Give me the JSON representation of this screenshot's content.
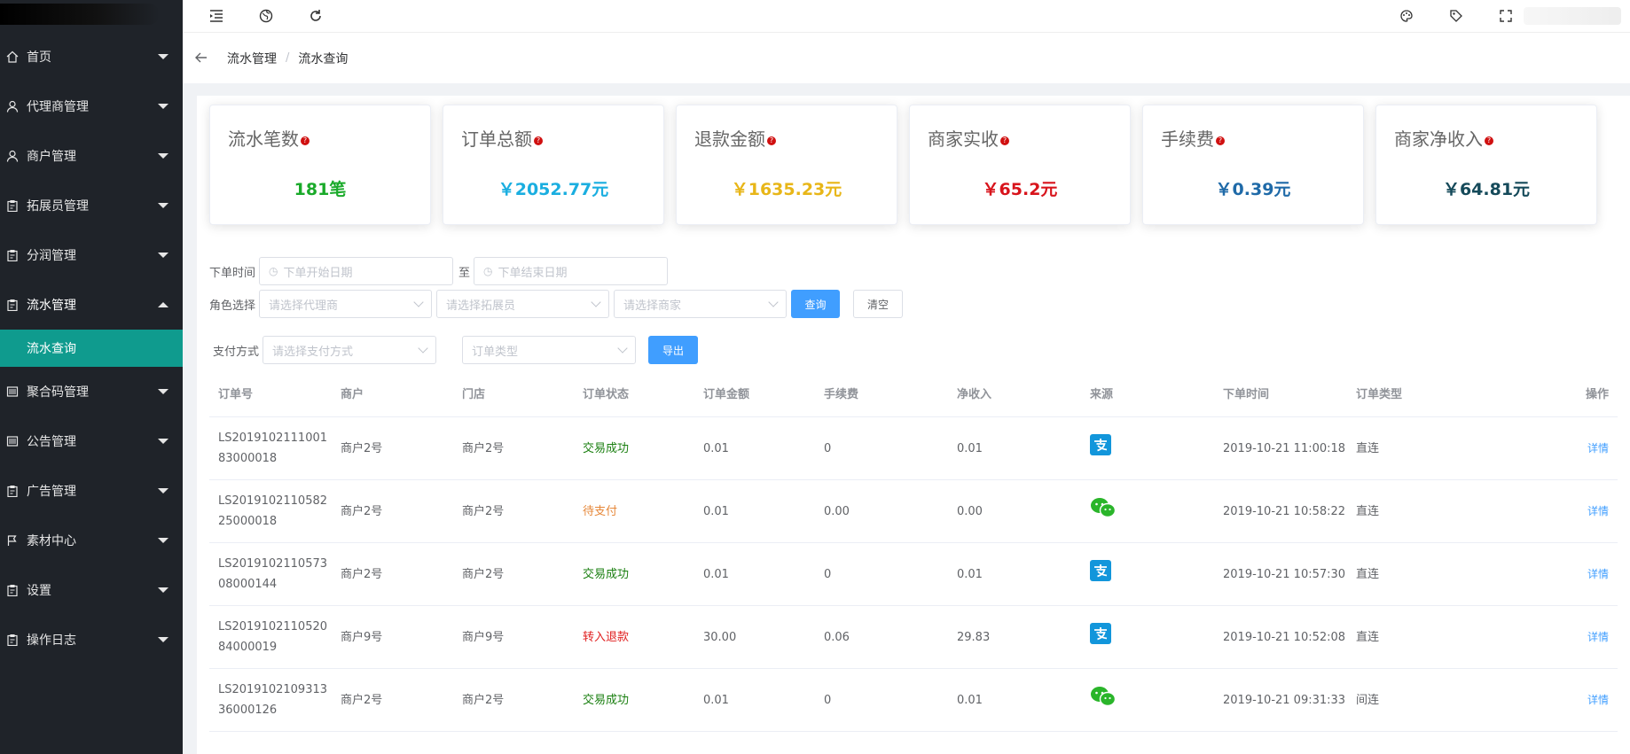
{
  "sidebar": {
    "items": [
      {
        "label": "首页",
        "icon": "home-icon"
      },
      {
        "label": "代理商管理",
        "icon": "user-icon"
      },
      {
        "label": "商户管理",
        "icon": "user-icon"
      },
      {
        "label": "拓展员管理",
        "icon": "clipboard-icon"
      },
      {
        "label": "分润管理",
        "icon": "clipboard-icon"
      },
      {
        "label": "流水管理",
        "icon": "clipboard-icon",
        "open": true
      },
      {
        "label": "聚合码管理",
        "icon": "barcode-icon"
      },
      {
        "label": "公告管理",
        "icon": "barcode-icon"
      },
      {
        "label": "广告管理",
        "icon": "clipboard-icon"
      },
      {
        "label": "素材中心",
        "icon": "flag-icon"
      },
      {
        "label": "设置",
        "icon": "clipboard-icon"
      },
      {
        "label": "操作日志",
        "icon": "clipboard-icon"
      }
    ],
    "submenu_active": "流水查询"
  },
  "header": {
    "left_icons": [
      "menu-fold-icon",
      "globe-icon",
      "refresh-icon"
    ],
    "right_icons": [
      "palette-icon",
      "tag-icon",
      "fullscreen-icon"
    ]
  },
  "breadcrumb": {
    "items": [
      "流水管理",
      "流水查询"
    ],
    "separator": "/"
  },
  "stats": [
    {
      "title": "流水笔数",
      "value": "181笔",
      "color": "#1aaa2a"
    },
    {
      "title": "订单总额",
      "value": "￥2052.77元",
      "color": "#1aaee0"
    },
    {
      "title": "退款金额",
      "value": "￥1635.23元",
      "color": "#e8b618"
    },
    {
      "title": "商家实收",
      "value": "￥65.2元",
      "color": "#d8141c"
    },
    {
      "title": "手续费",
      "value": "￥0.39元",
      "color": "#1f6aa8"
    },
    {
      "title": "商家净收入",
      "value": "￥64.81元",
      "color": "#154a5a"
    }
  ],
  "filters": {
    "order_time_label": "下单时间",
    "start_date_placeholder": "下单开始日期",
    "to_label": "至",
    "end_date_placeholder": "下单结束日期",
    "role_label": "角色选择",
    "agent_placeholder": "请选择代理商",
    "promoter_placeholder": "请选择拓展员",
    "merchant_placeholder": "请选择商家",
    "query_button": "查询",
    "clear_button": "清空",
    "pay_method_label": "支付方式",
    "pay_method_placeholder": "请选择支付方式",
    "order_type_placeholder": "订单类型",
    "export_button": "导出"
  },
  "table": {
    "columns": [
      "订单号",
      "商户",
      "门店",
      "订单状态",
      "订单金额",
      "手续费",
      "净收入",
      "来源",
      "下单时间",
      "订单类型",
      "操作"
    ],
    "rows": [
      {
        "order_no": "LS201910211100183000018",
        "merchant": "商户2号",
        "store": "商户2号",
        "status": "交易成功",
        "status_class": "success",
        "amount": "0.01",
        "fee": "0",
        "net": "0.01",
        "source": "alipay",
        "time": "2019-10-21 11:00:18",
        "type": "直连",
        "action": "详情"
      },
      {
        "order_no": "LS201910211058225000018",
        "merchant": "商户2号",
        "store": "商户2号",
        "status": "待支付",
        "status_class": "pending",
        "amount": "0.01",
        "fee": "0.00",
        "net": "0.00",
        "source": "wechat",
        "time": "2019-10-21 10:58:22",
        "type": "直连",
        "action": "详情"
      },
      {
        "order_no": "LS201910211057308000144",
        "merchant": "商户2号",
        "store": "商户2号",
        "status": "交易成功",
        "status_class": "success",
        "amount": "0.01",
        "fee": "0",
        "net": "0.01",
        "source": "alipay",
        "time": "2019-10-21 10:57:30",
        "type": "直连",
        "action": "详情"
      },
      {
        "order_no": "LS201910211052084000019",
        "merchant": "商户9号",
        "store": "商户9号",
        "status": "转入退款",
        "status_class": "refund",
        "amount": "30.00",
        "fee": "0.06",
        "net": "29.83",
        "source": "alipay",
        "time": "2019-10-21 10:52:08",
        "type": "直连",
        "action": "详情"
      },
      {
        "order_no": "LS201910210931336000126",
        "merchant": "商户2号",
        "store": "商户2号",
        "status": "交易成功",
        "status_class": "success",
        "amount": "0.01",
        "fee": "0",
        "net": "0.01",
        "source": "wechat",
        "time": "2019-10-21 09:31:33",
        "type": "间连",
        "action": "详情"
      }
    ]
  },
  "colors": {
    "sidebar_bg": "#1f2329",
    "active_menu": "#0f9b8e",
    "primary": "#409eff"
  }
}
